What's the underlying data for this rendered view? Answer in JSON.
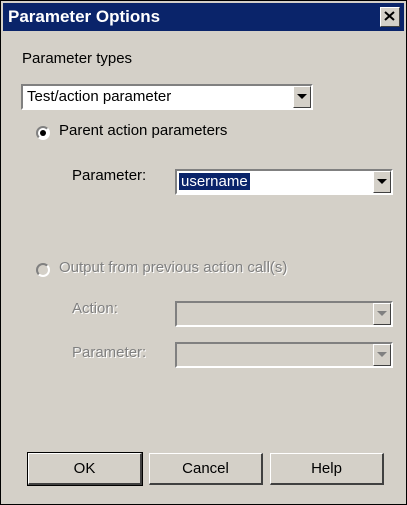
{
  "window": {
    "title": "Parameter Options",
    "close_icon": "close-icon"
  },
  "parameter_types": {
    "label": "Parameter types",
    "selected": "Test/action parameter"
  },
  "parent_action": {
    "label": "Parent action parameters",
    "selected": true,
    "parameter_label": "Parameter:",
    "parameter_value": "username"
  },
  "output_previous": {
    "label": "Output from previous action call(s)",
    "enabled": false,
    "action_label": "Action:",
    "action_value": "",
    "parameter_label": "Parameter:",
    "parameter_value": ""
  },
  "buttons": {
    "ok": "OK",
    "cancel": "Cancel",
    "help": "Help"
  },
  "colors": {
    "titlebar": "#0a246a",
    "dialog_bg": "#d4d0c8",
    "selection": "#0a246a",
    "disabled_text": "#808080"
  }
}
